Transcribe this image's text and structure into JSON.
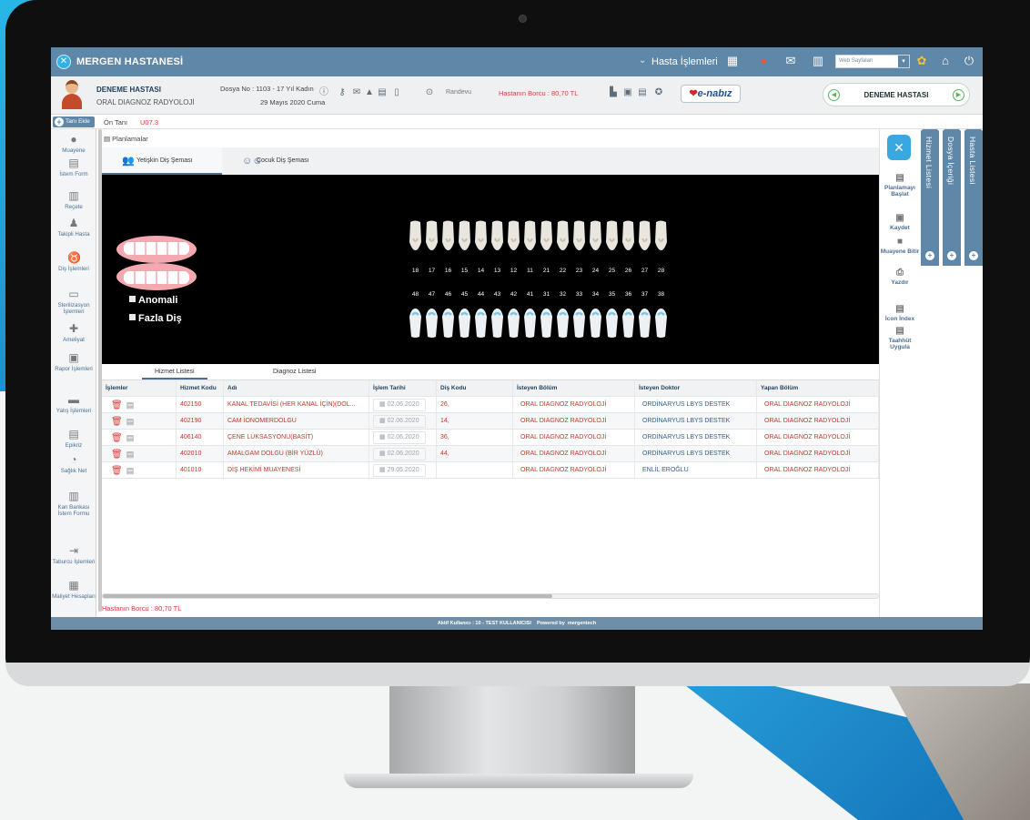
{
  "app": {
    "title": "MERGEN HASTANESİ",
    "menu_label": "Hasta İşlemleri",
    "web_select_value": "Web Sayfaları"
  },
  "patient": {
    "name": "DENEME HASTASI",
    "department": "ORAL DIAGNOZ RADYOLOJİ",
    "dosya": "Dosya No : 1103 - 17 Yıl Kadın",
    "date": "29 Mayıs 2020 Cuma",
    "randevu": "Randevu",
    "borc": "Hastanın Borcu : 80,70 TL",
    "enabiz": "e-nabız",
    "nav_name": "DENEME HASTASI"
  },
  "diagnosis": {
    "add_label": "Tanı Ekle",
    "on_tani_label": "Ön Tanı",
    "on_tani_code": "U07.3"
  },
  "sidebar": {
    "items": [
      {
        "label": "Muayene",
        "icon": "chat-icon"
      },
      {
        "label": "İstem Form",
        "icon": "form-icon"
      },
      {
        "label": "Reçete",
        "icon": "prescription-icon"
      },
      {
        "label": "Takipli Hasta",
        "icon": "user-follow-icon"
      },
      {
        "label": "Diş İşlemleri",
        "icon": "tooth-icon"
      },
      {
        "label": "Sterilizasyon İşlemleri",
        "icon": "sterilization-icon"
      },
      {
        "label": "Ameliyat",
        "icon": "surgery-icon"
      },
      {
        "label": "Rapor İşlemleri",
        "icon": "report-icon"
      },
      {
        "label": "Yatış İşlemleri",
        "icon": "bed-icon"
      },
      {
        "label": "Epikriz",
        "icon": "epikriz-icon"
      },
      {
        "label": "Sağlık Net",
        "icon": "health-net-icon"
      },
      {
        "label": "Kan Bankası İstem Formu",
        "icon": "blood-bank-icon"
      },
      {
        "label": "Taburcu İşlemleri",
        "icon": "discharge-icon"
      },
      {
        "label": "Maliyet Hesapları",
        "icon": "calculator-icon"
      }
    ]
  },
  "planning": {
    "header": "Planlamalar",
    "tabs": [
      "Yetişkin Diş Şeması",
      "Çocuk Diş Şeması"
    ],
    "legend": [
      "Anomali",
      "Fazla Diş"
    ],
    "upper_teeth": [
      "18",
      "17",
      "16",
      "15",
      "14",
      "13",
      "12",
      "11",
      "21",
      "22",
      "23",
      "24",
      "25",
      "26",
      "27",
      "28"
    ],
    "lower_teeth": [
      "48",
      "47",
      "46",
      "45",
      "44",
      "43",
      "42",
      "41",
      "31",
      "32",
      "33",
      "34",
      "35",
      "36",
      "37",
      "38"
    ]
  },
  "list_tabs": [
    "Hizmet Listesi",
    "Diagnoz Listesi"
  ],
  "table": {
    "headers": [
      "İşlemler",
      "Hizmet Kodu",
      "Adı",
      "İşlem Tarihi",
      "Diş Kodu",
      "İsteyen Bölüm",
      "İsteyen Doktor",
      "Yapan Bölüm"
    ],
    "rows": [
      {
        "kod": "402150",
        "adi": "KANAL TEDAVİSİ (HER KANAL İÇİN)(DOL...",
        "tarih": "02.06.2020",
        "dis": "26,",
        "bolum": "ORAL DIAGNOZ RADYOLOJİ",
        "doktor": "ORDİNARYUS LBYS DESTEK",
        "yapan": "ORAL DIAGNOZ RADYOLOJİ"
      },
      {
        "kod": "402190",
        "adi": "CAM İONOMERDOLGU",
        "tarih": "02.06.2020",
        "dis": "14,",
        "bolum": "ORAL DIAGNOZ RADYOLOJİ",
        "doktor": "ORDİNARYUS LBYS DESTEK",
        "yapan": "ORAL DIAGNOZ RADYOLOJİ"
      },
      {
        "kod": "406140",
        "adi": "ÇENE LÜKSASYONU(BASİT)",
        "tarih": "02.06.2020",
        "dis": "36,",
        "bolum": "ORAL DIAGNOZ RADYOLOJİ",
        "doktor": "ORDİNARYUS LBYS DESTEK",
        "yapan": "ORAL DIAGNOZ RADYOLOJİ"
      },
      {
        "kod": "402010",
        "adi": "AMALGAM DOLGU (BİR YÜZLÜ)",
        "tarih": "02.06.2020",
        "dis": "44,",
        "bolum": "ORAL DIAGNOZ RADYOLOJİ",
        "doktor": "ORDİNARYUS LBYS DESTEK",
        "yapan": "ORAL DIAGNOZ RADYOLOJİ"
      },
      {
        "kod": "401010",
        "adi": "DİŞ HEKİMİ MUAYENESİ",
        "tarih": "29.05.2020",
        "dis": "",
        "bolum": "ORAL DIAGNOZ RADYOLOJİ",
        "doktor": "ENLİL EROĞLU",
        "yapan": "ORAL DIAGNOZ RADYOLOJİ"
      }
    ]
  },
  "footer": {
    "borc": "Hastanın Borcu : 80,70 TL",
    "status": "Aktif Kullanıcı : 10 - TEST KULLANICISI",
    "powered": "Powered by",
    "brand": "mergentech"
  },
  "right_panel": {
    "items": [
      "Planlamayı Başlat",
      "Kaydet",
      "Muayene Bitir",
      "Yazdır",
      "İcon İndex",
      "Taahhüt Uygula"
    ]
  },
  "vertical_tabs": [
    "Hizmet Listesi",
    "Dosya İçeriği",
    "Hasta Listesi"
  ],
  "colors": {
    "primary": "#5f87a8",
    "accent_red": "#d23a3a",
    "link_blue": "#2f5d92",
    "enabiz_blue": "#1f4f91"
  }
}
